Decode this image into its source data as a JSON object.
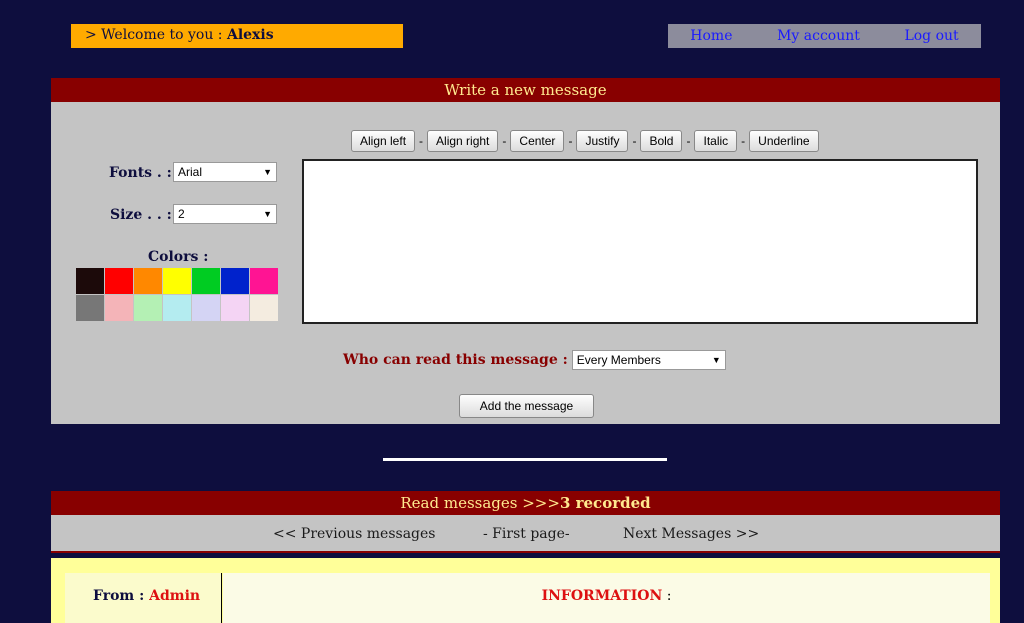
{
  "header": {
    "welcome_prefix": "> Welcome to you : ",
    "username": "Alexis",
    "nav": {
      "home": "Home",
      "account": "My account",
      "logout": "Log out"
    }
  },
  "write": {
    "title": "Write a new message",
    "toolbar": [
      "Align left",
      "Align right",
      "Center",
      "Justify",
      "Bold",
      "Italic",
      "Underline"
    ],
    "separator": "-",
    "fonts_label": "Fonts . :",
    "fonts_value": "Arial",
    "size_label": "Size . . :",
    "size_value": "2",
    "colors_label": "Colors :",
    "colors_row1": [
      "#1c0a0a",
      "#ff0000",
      "#ff8800",
      "#ffff00",
      "#00cc22",
      "#0022cc",
      "#ff1493"
    ],
    "colors_row2": [
      "#777777",
      "#f4b4b8",
      "#b4f0b4",
      "#b4ecf0",
      "#d4d4f4",
      "#f4d4f4",
      "#f4ece0"
    ],
    "who_label": "Who can read this message :",
    "who_value": "Every Members",
    "add_button": "Add the message"
  },
  "read": {
    "title_prefix": "Read messages >>> ",
    "count": "3 recorded",
    "prev": "<< Previous messages",
    "first": "- First page-",
    "next": "Next Messages >>",
    "message": {
      "from_label": "From :",
      "from_name": "Admin",
      "subject": "INFORMATION",
      "subject_suffix": " :"
    }
  }
}
